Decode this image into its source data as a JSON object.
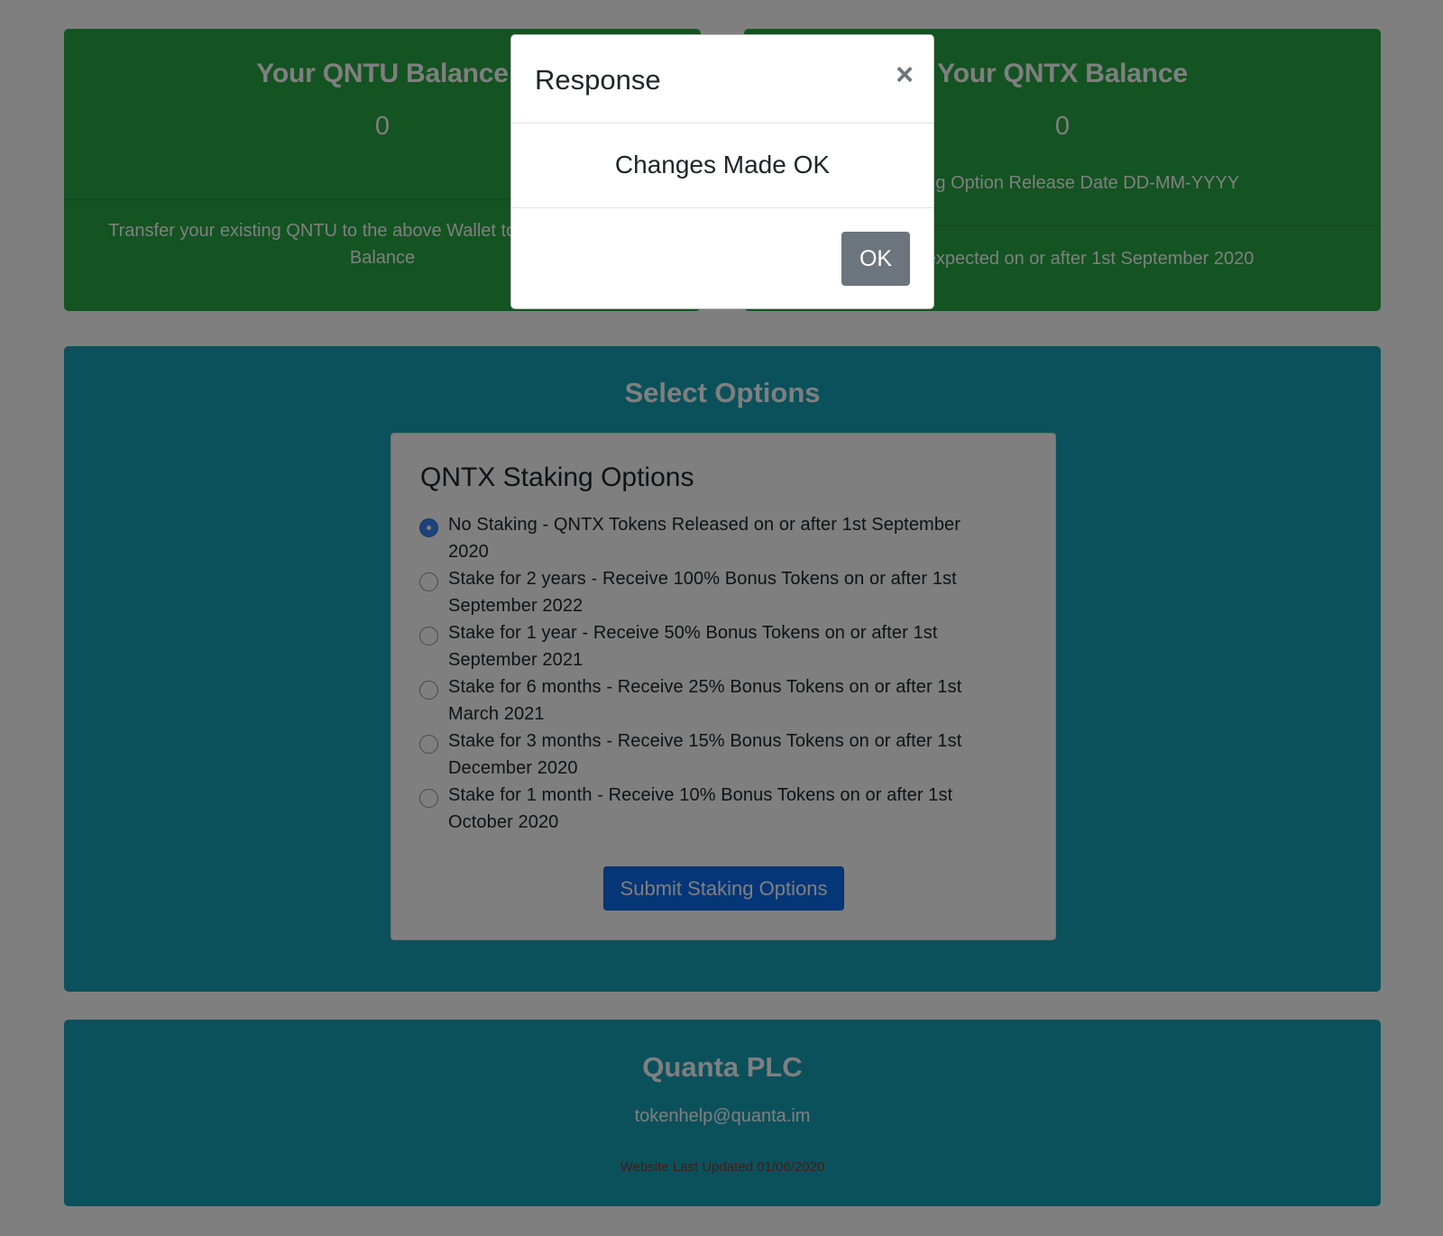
{
  "colors": {
    "balance_card": "#28a745",
    "info_panel": "#17a2b8",
    "primary_button": "#0b6cf0",
    "secondary_button": "#6c757d",
    "overlay": "rgba(0,0,0,0.5)"
  },
  "qntu_card": {
    "title": "Your QNTU Balance",
    "value": "0",
    "footer": "Transfer your existing QNTU to the above Wallet to add them to your Balance"
  },
  "qntx_card": {
    "title": "Your QNTX Balance",
    "value": "0",
    "note": "Staking Option Release Date DD-MM-YYYY",
    "footer": "QNTX expected on or after 1st September 2020"
  },
  "options": {
    "title": "Select Options",
    "staking_heading": "QNTX Staking Options",
    "items": [
      {
        "label": "No Staking - QNTX Tokens Released on or after 1st September 2020",
        "checked": true
      },
      {
        "label": "Stake for 2 years - Receive 100% Bonus Tokens on or after 1st September 2022",
        "checked": false
      },
      {
        "label": "Stake for 1 year - Receive 50% Bonus Tokens on or after 1st September 2021",
        "checked": false
      },
      {
        "label": "Stake for 6 months - Receive 25% Bonus Tokens on or after 1st March 2021",
        "checked": false
      },
      {
        "label": "Stake for 3 months - Receive 15% Bonus Tokens on or after 1st December 2020",
        "checked": false
      },
      {
        "label": "Stake for 1 month - Receive 10% Bonus Tokens on or after 1st October 2020",
        "checked": false
      }
    ],
    "submit_label": "Submit Staking Options"
  },
  "footer": {
    "company": "Quanta PLC",
    "email": "tokenhelp@quanta.im",
    "updated": "Website Last Updated 01/06/2020"
  },
  "modal": {
    "title": "Response",
    "close_glyph": "×",
    "message": "Changes Made OK",
    "ok_label": "OK"
  }
}
